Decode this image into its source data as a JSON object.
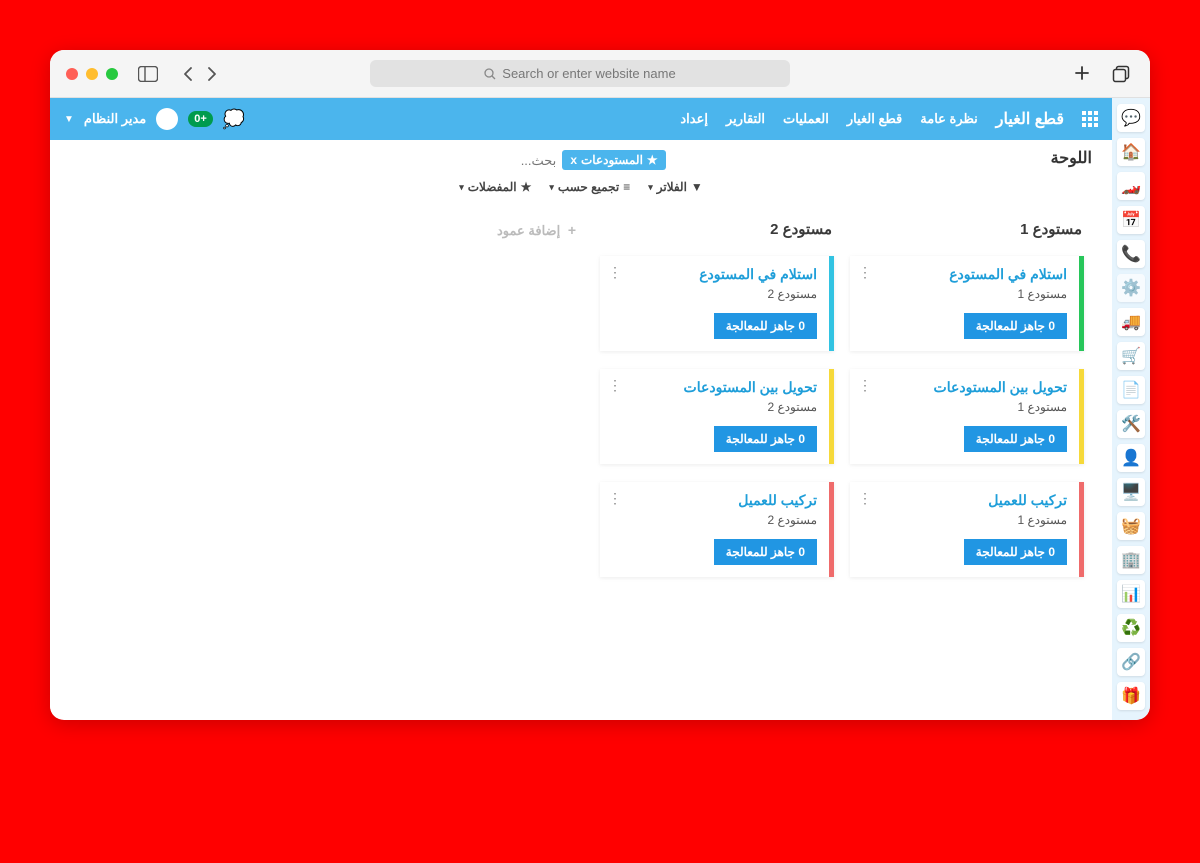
{
  "browser": {
    "address_placeholder": "Search or enter website name"
  },
  "topbar": {
    "app_title": "قطع الغيار",
    "nav": [
      "نظرة عامة",
      "قطع الغيار",
      "العمليات",
      "التقارير",
      "إعداد"
    ],
    "user_name": "مدير النظام",
    "notif_badge": "+0"
  },
  "page": {
    "title": "اللوحة",
    "search_chip": "المستودعات",
    "search_chip_close": "x",
    "search_placeholder": "بحث...",
    "filters": {
      "filter": "الفلاتر",
      "groupby": "تجميع حسب",
      "favorites": "المفضلات"
    },
    "add_column": "إضافة عمود"
  },
  "columns": [
    {
      "title": "مستودع 1",
      "cards": [
        {
          "title": "استلام في المستودع",
          "sub": "مستودع 1",
          "badge": "0 جاهز للمعالجة",
          "color": "c-green"
        },
        {
          "title": "تحويل بين المستودعات",
          "sub": "مستودع 1",
          "badge": "0 جاهز للمعالجة",
          "color": "c-yellow"
        },
        {
          "title": "تركيب للعميل",
          "sub": "مستودع 1",
          "badge": "0 جاهز للمعالجة",
          "color": "c-red"
        }
      ]
    },
    {
      "title": "مستودع 2",
      "cards": [
        {
          "title": "استلام في المستودع",
          "sub": "مستودع 2",
          "badge": "0 جاهز للمعالجة",
          "color": "c-cyan"
        },
        {
          "title": "تحويل بين المستودعات",
          "sub": "مستودع 2",
          "badge": "0 جاهز للمعالجة",
          "color": "c-yellow"
        },
        {
          "title": "تركيب للعميل",
          "sub": "مستودع 2",
          "badge": "0 جاهز للمعالجة",
          "color": "c-red"
        }
      ]
    }
  ]
}
